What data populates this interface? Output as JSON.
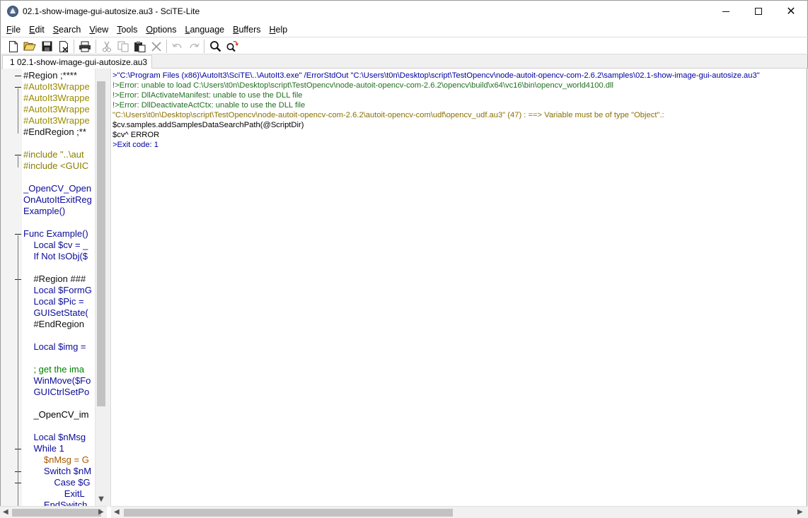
{
  "window": {
    "title": "02.1-show-image-gui-autosize.au3 - SciTE-Lite",
    "close_glyph": "✕"
  },
  "menu": [
    {
      "prefix": "",
      "ul": "F",
      "rest": "ile"
    },
    {
      "prefix": "",
      "ul": "E",
      "rest": "dit"
    },
    {
      "prefix": "",
      "ul": "S",
      "rest": "earch"
    },
    {
      "prefix": "",
      "ul": "V",
      "rest": "iew"
    },
    {
      "prefix": "",
      "ul": "T",
      "rest": "ools"
    },
    {
      "prefix": "",
      "ul": "O",
      "rest": "ptions"
    },
    {
      "prefix": "",
      "ul": "L",
      "rest": "anguage"
    },
    {
      "prefix": "",
      "ul": "B",
      "rest": "uffers"
    },
    {
      "prefix": "",
      "ul": "H",
      "rest": "elp"
    }
  ],
  "toolbar": {
    "icons": [
      "new-file-icon",
      "open-folder-icon",
      "save-icon",
      "close-file-icon",
      "print-icon",
      "cut-icon",
      "copy-icon",
      "paste-icon",
      "delete-icon",
      "undo-icon",
      "redo-icon",
      "find-icon",
      "replace-icon"
    ]
  },
  "tab": {
    "label": "1 02.1-show-image-gui-autosize.au3"
  },
  "editor": {
    "lines": [
      {
        "text": "#Region ;****",
        "style": "c-dir"
      },
      {
        "text": "#AutoIt3Wrappe",
        "style": "c-wrap"
      },
      {
        "text": "#AutoIt3Wrappe",
        "style": "c-wrap"
      },
      {
        "text": "#AutoIt3Wrappe",
        "style": "c-wrap"
      },
      {
        "text": "#AutoIt3Wrappe",
        "style": "c-wrap"
      },
      {
        "text": "#EndRegion ;**",
        "style": "c-dir"
      },
      {
        "text": "",
        "style": "c-def"
      },
      {
        "text": "#include \"..\\aut",
        "style": "c-inc"
      },
      {
        "text": "#include <GUIC",
        "style": "c-inc"
      },
      {
        "text": "",
        "style": "c-def"
      },
      {
        "text": "_OpenCV_Open",
        "style": "c-kw"
      },
      {
        "text": "OnAutoItExitReg",
        "style": "c-kw"
      },
      {
        "text": "Example()",
        "style": "c-kw"
      },
      {
        "text": "",
        "style": "c-def"
      },
      {
        "text": "Func Example()",
        "style": "c-kw"
      },
      {
        "text": "    Local $cv = _",
        "style": "c-kw"
      },
      {
        "text": "    If Not IsObj($",
        "style": "c-kw"
      },
      {
        "text": "",
        "style": "c-def"
      },
      {
        "text": "    #Region ###",
        "style": "c-dir"
      },
      {
        "text": "    Local $FormG",
        "style": "c-kw"
      },
      {
        "text": "    Local $Pic = ",
        "style": "c-kw"
      },
      {
        "text": "    GUISetState(",
        "style": "c-kw"
      },
      {
        "text": "    #EndRegion",
        "style": "c-dir"
      },
      {
        "text": "",
        "style": "c-def"
      },
      {
        "text": "    Local $img =",
        "style": "c-kw"
      },
      {
        "text": "",
        "style": "c-def"
      },
      {
        "text": "    ; get the ima",
        "style": "c-com"
      },
      {
        "text": "    WinMove($Fo",
        "style": "c-kw"
      },
      {
        "text": "    GUICtrlSetPo",
        "style": "c-kw"
      },
      {
        "text": "",
        "style": "c-def"
      },
      {
        "text": "    _OpenCV_im",
        "style": "c-def"
      },
      {
        "text": "",
        "style": "c-def"
      },
      {
        "text": "    Local $nMsg",
        "style": "c-kw"
      },
      {
        "text": "    While 1",
        "style": "c-kw"
      },
      {
        "text": "        $nMsg = G",
        "style": "c-var"
      },
      {
        "text": "        Switch $nM",
        "style": "c-kw"
      },
      {
        "text": "            Case $G",
        "style": "c-kw"
      },
      {
        "text": "                ExitL",
        "style": "c-kw"
      },
      {
        "text": "        EndSwitch",
        "style": "c-kw"
      }
    ]
  },
  "output": {
    "lines": [
      {
        "text": ">\"C:\\Program Files (x86)\\AutoIt3\\SciTE\\..\\AutoIt3.exe\" /ErrorStdOut \"C:\\Users\\t0n\\Desktop\\script\\TestOpencv\\node-autoit-opencv-com-2.6.2\\samples\\02.1-show-image-gui-autosize.au3\"",
        "style": "o-blue"
      },
      {
        "text": "!>Error: unable to load C:\\Users\\t0n\\Desktop\\script\\TestOpencv\\node-autoit-opencv-com-2.6.2\\opencv\\build\\x64\\vc16\\bin\\opencv_world4100.dll",
        "style": "o-green"
      },
      {
        "text": "!>Error: DllActivateManifest: unable to use the DLL file",
        "style": "o-green"
      },
      {
        "text": "!>Error: DllDeactivateActCtx: unable to use the DLL file",
        "style": "o-green"
      },
      {
        "text": "\"C:\\Users\\t0n\\Desktop\\script\\TestOpencv\\node-autoit-opencv-com-2.6.2\\autoit-opencv-com\\udf\\opencv_udf.au3\" (47) : ==> Variable must be of type \"Object\".:",
        "style": "o-olive"
      },
      {
        "text": "$cv.samples.addSamplesDataSearchPath(@ScriptDir)",
        "style": "o-black"
      },
      {
        "text": "$cv^ ERROR",
        "style": "o-black"
      },
      {
        "text": ">Exit code: 1",
        "style": "o-blue"
      }
    ]
  }
}
